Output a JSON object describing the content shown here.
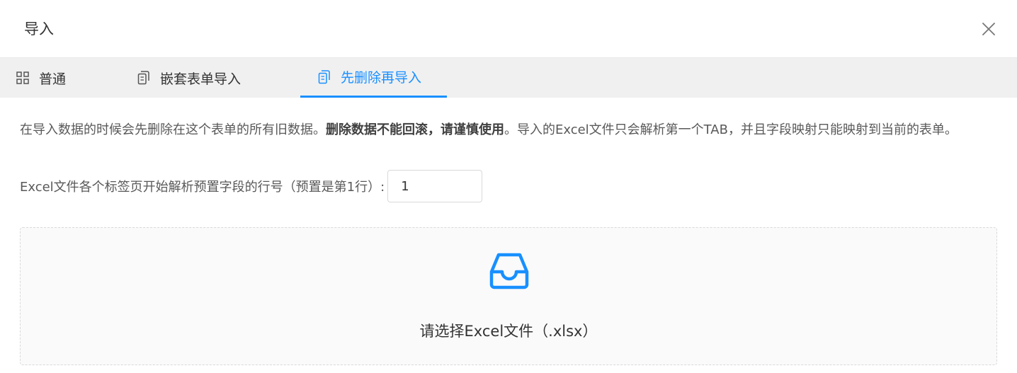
{
  "dialog": {
    "title": "导入",
    "close_icon": "close-icon"
  },
  "tabs": [
    {
      "label": "普通",
      "icon": "grid-icon",
      "active": false
    },
    {
      "label": "嵌套表单导入",
      "icon": "copy-icon",
      "active": false
    },
    {
      "label": "先删除再导入",
      "icon": "copy-icon",
      "active": true
    }
  ],
  "content": {
    "desc_part1": "在导入数据的时候会先删除在这个表单的所有旧数据。",
    "desc_bold": "删除数据不能回滚，请谨慎使用",
    "desc_part2": "。导入的Excel文件只会解析第一个TAB，并且字段映射只能映射到当前的表单。",
    "row_label": "Excel文件各个标签页开始解析预置字段的行号（预置是第1行）:",
    "row_value": "1",
    "upload_text": "请选择Excel文件（.xlsx）",
    "upload_icon": "inbox-icon"
  },
  "colors": {
    "accent": "#1890ff",
    "tab_bar_bg": "#f0f0f0",
    "upload_bg": "#fafafa"
  }
}
